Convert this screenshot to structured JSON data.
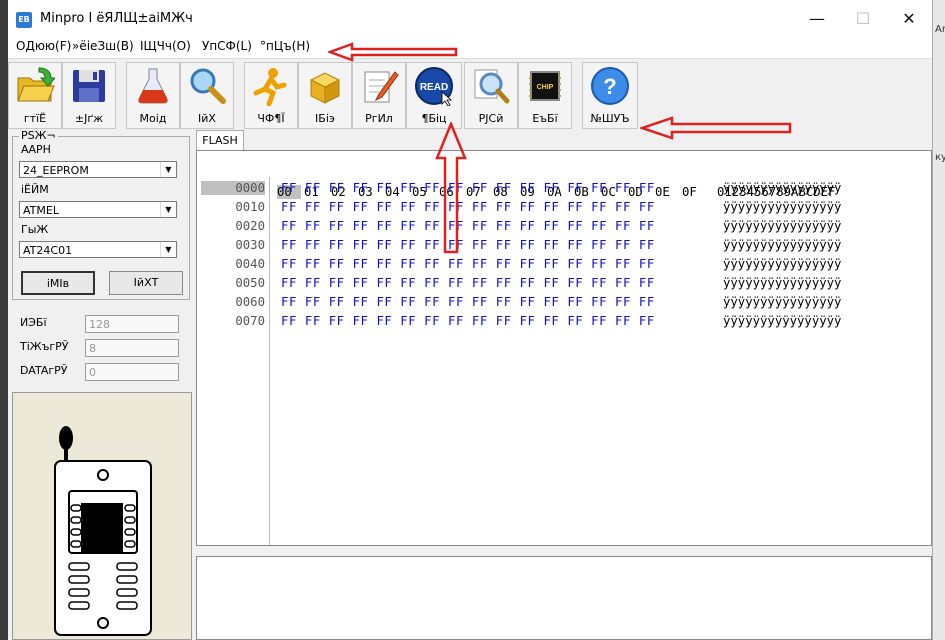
{
  "window": {
    "title": "Minpro I ёЯЛЩ±аіМЖч",
    "minimize": "—",
    "maximize": "☐",
    "close": "✕"
  },
  "outside_right": [
    "Arr",
    "ку"
  ],
  "menu": [
    {
      "label": "ОДюю(F)"
    },
    {
      "label": "»ёіеЗш(B)"
    },
    {
      "label": "ІЩЧч(O)"
    },
    {
      "label": "УпСФ(L)"
    },
    {
      "label": "°пЦъ(H)"
    }
  ],
  "toolbar": [
    {
      "label": "",
      "icon": "open-folder-icon"
    },
    {
      "label": "±Јґж",
      "icon": "save-floppy-icon"
    },
    {
      "label": "Моід",
      "icon": "flask-icon"
    },
    {
      "label": "ІйХ",
      "icon": "magnifier-icon"
    },
    {
      "label": "ЧФ¶Ї",
      "icon": "runner-icon"
    },
    {
      "label": "ІБіэ",
      "icon": "box-icon"
    },
    {
      "label": "РгИл",
      "icon": "pencil-paper-icon"
    },
    {
      "label": "¶Біц",
      "icon": "read-button-icon",
      "icon_text": "READ"
    },
    {
      "label": "РЈСй",
      "icon": "verify-magnifier-icon"
    },
    {
      "label": "ЕъБї",
      "icon": "chip-icon",
      "icon_text": "CHIP"
    },
    {
      "label": "№ШУЪ",
      "icon": "help-icon"
    }
  ],
  "toolbar_first_label": "гтїЁ",
  "chip_select": {
    "group_title": "РЅЖ¬",
    "type_label": "ААРН",
    "type_value": "24_EEPROM",
    "maker_label": "іЁЙМ",
    "maker_value": "ATMEL",
    "model_label": "ГыЖ",
    "model_value": "AT24C01",
    "btn_select": "іМІв",
    "btn_detect": "ІйХТ"
  },
  "chip_info": [
    {
      "label": "ИЭБї",
      "value": "128"
    },
    {
      "label": "ТіЖъгРЎ",
      "value": "8"
    },
    {
      "label": "DATAгРЎ",
      "value": "0"
    }
  ],
  "tab_label": "FLASH",
  "hex": {
    "columns": [
      "00",
      "01",
      "02",
      "03",
      "04",
      "05",
      "06",
      "07",
      "08",
      "09",
      "0A",
      "0B",
      "0C",
      "0D",
      "0E",
      "0F"
    ],
    "ascii_header": "0123456789ABCDEF",
    "rows": [
      {
        "addr": "0000",
        "bytes": "FF FF FF FF FF FF FF FF FF FF FF FF FF FF FF FF",
        "ascii": "ÿÿÿÿÿÿÿÿÿÿÿÿÿÿÿÿ"
      },
      {
        "addr": "0010",
        "bytes": "FF FF FF FF FF FF FF FF FF FF FF FF FF FF FF FF",
        "ascii": "ÿÿÿÿÿÿÿÿÿÿÿÿÿÿÿÿ"
      },
      {
        "addr": "0020",
        "bytes": "FF FF FF FF FF FF FF FF FF FF FF FF FF FF FF FF",
        "ascii": "ÿÿÿÿÿÿÿÿÿÿÿÿÿÿÿÿ"
      },
      {
        "addr": "0030",
        "bytes": "FF FF FF FF FF FF FF FF FF FF FF FF FF FF FF FF",
        "ascii": "ÿÿÿÿÿÿÿÿÿÿÿÿÿÿÿÿ"
      },
      {
        "addr": "0040",
        "bytes": "FF FF FF FF FF FF FF FF FF FF FF FF FF FF FF FF",
        "ascii": "ÿÿÿÿÿÿÿÿÿÿÿÿÿÿÿÿ"
      },
      {
        "addr": "0050",
        "bytes": "FF FF FF FF FF FF FF FF FF FF FF FF FF FF FF FF",
        "ascii": "ÿÿÿÿÿÿÿÿÿÿÿÿÿÿÿÿ"
      },
      {
        "addr": "0060",
        "bytes": "FF FF FF FF FF FF FF FF FF FF FF FF FF FF FF FF",
        "ascii": "ÿÿÿÿÿÿÿÿÿÿÿÿÿÿÿÿ"
      },
      {
        "addr": "0070",
        "bytes": "FF FF FF FF FF FF FF FF FF FF FF FF FF FF FF FF",
        "ascii": "ÿÿÿÿÿÿÿÿÿÿÿÿÿÿÿÿ"
      }
    ]
  },
  "colors": {
    "hex_bytes": "#1010c8",
    "annotation": "#e02020",
    "chip_bg": "#ece9d8"
  },
  "annotations": [
    "red-arrow-to-help-menu",
    "red-arrow-to-help-button",
    "red-arrow-to-read-button"
  ]
}
